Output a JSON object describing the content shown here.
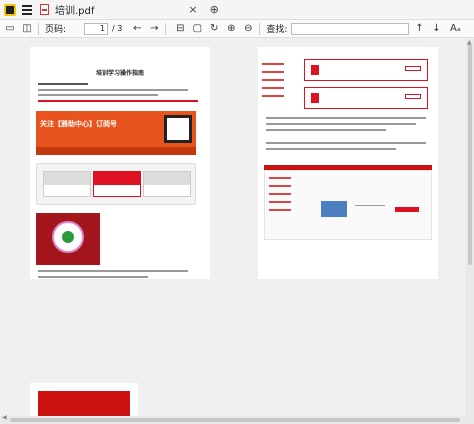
{
  "window": {
    "tab_title": "培训.pdf",
    "close_symbol": "×",
    "new_tab_symbol": "⊕"
  },
  "toolbar": {
    "page_label": "页码:",
    "current_page": "1",
    "page_separator": "/ 3",
    "search_label": "查找:",
    "search_value": "",
    "icons": [
      "folder-icon",
      "save-icon",
      "back-icon",
      "forward-icon",
      "fit-page-icon",
      "fit-width-icon",
      "rotate-icon",
      "zoom-in-icon",
      "zoom-out-icon",
      "find-prev-icon",
      "find-next-icon",
      "match-case-icon"
    ],
    "glyphs": {
      "back": "←",
      "forward": "→",
      "prev": "↑",
      "next": "↓",
      "case": "Aₐ"
    }
  },
  "document": {
    "page1": {
      "title": "培训学习操作指南",
      "banner_text": "关注【雅助中心】订阅号"
    }
  },
  "colors": {
    "accent_red": "#d12222",
    "banner_orange": "#e8541e",
    "app_logo_yellow": "#f2c700"
  }
}
